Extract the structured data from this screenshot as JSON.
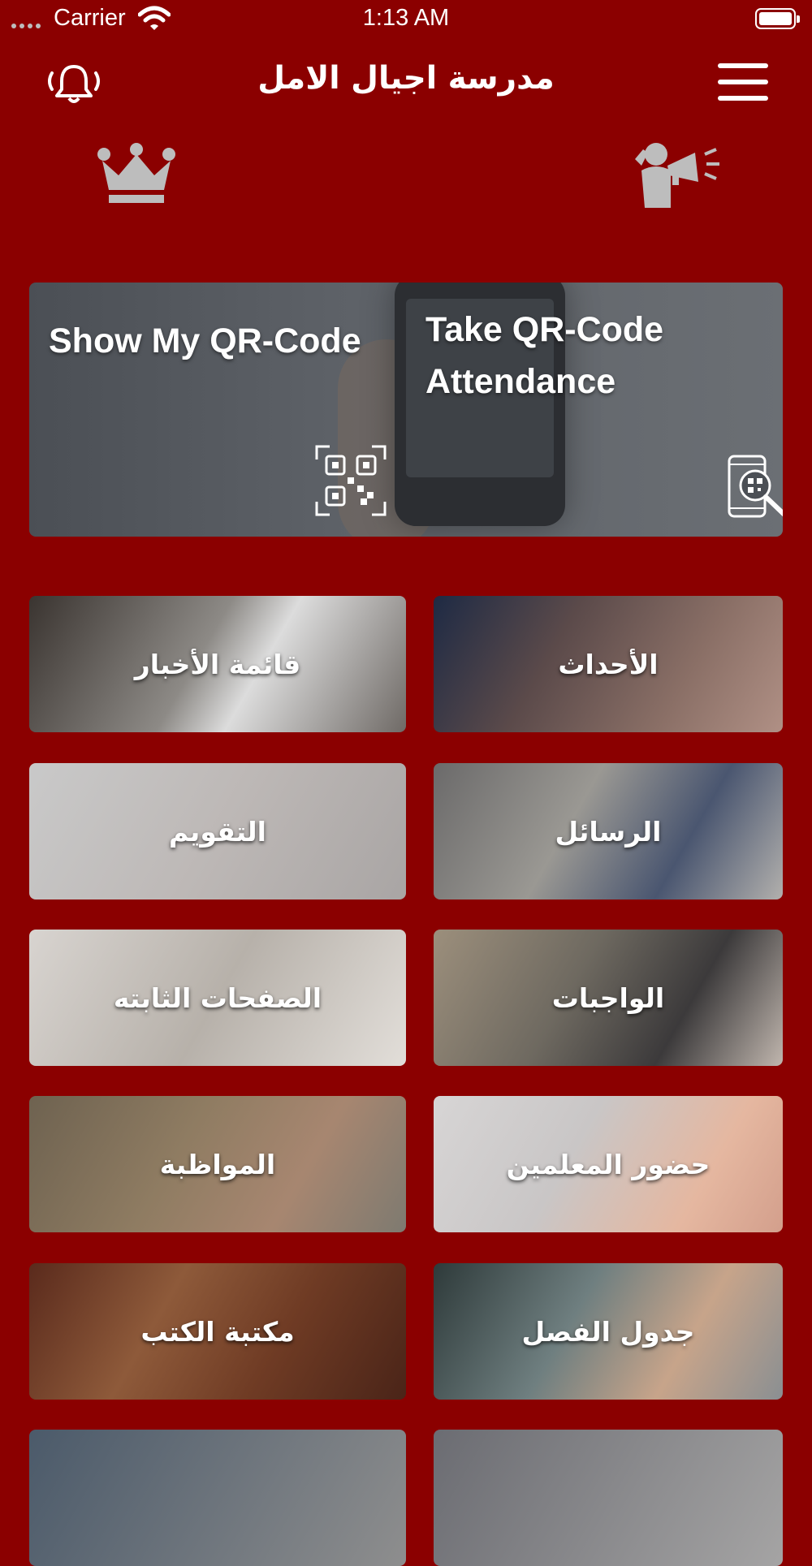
{
  "status_bar": {
    "carrier": "Carrier",
    "time": "1:13 AM"
  },
  "header": {
    "title": "مدرسة اجيال الامل"
  },
  "qr": {
    "show_label": "Show My QR-Code",
    "take_label": "Take QR-Code Attendance"
  },
  "tiles": [
    {
      "label": "قائمة الأخبار",
      "bg": "linear-gradient(120deg,#3a3430 0%,#8d8a86 45%,#dcdcdc 60%,#6f6a66 100%)"
    },
    {
      "label": "الأحداث",
      "bg": "linear-gradient(120deg,#1e2a44 0%,#5b4a4a 35%,#8a6f66 70%,#b09085 100%)"
    },
    {
      "label": "التقويم",
      "bg": "linear-gradient(120deg,#c9c9c9 0%,#bdb8b6 50%,#a9a5a4 100%)"
    },
    {
      "label": "الرسائل",
      "bg": "linear-gradient(120deg,#6b6a6a 0%,#9a9893 40%,#4a5670 70%,#b2b0ad 100%)"
    },
    {
      "label": "الصفحات الثابته",
      "bg": "linear-gradient(120deg,#d8d4d0 0%,#b7b1aa 50%,#e2ded9 100%)"
    },
    {
      "label": "الواجبات",
      "bg": "linear-gradient(120deg,#9c8f7c 0%,#6e6960 40%,#3c3a3b 70%,#c0b6ae 100%)"
    },
    {
      "label": "المواظبة",
      "bg": "linear-gradient(120deg,#6e6250 0%,#8f7c62 40%,#a78670 70%,#7e7a70 100%)"
    },
    {
      "label": "حضور المعلمين",
      "bg": "linear-gradient(120deg,#d7d5d5 0%,#c9c6c6 40%,#e5b7a0 75%,#d39f8c 100%)"
    },
    {
      "label": "مكتبة الكتب",
      "bg": "linear-gradient(120deg,#5a2a1c 0%,#8e5a3a 35%,#6f3b24 65%,#4a2418 100%)"
    },
    {
      "label": "جدول الفصل",
      "bg": "linear-gradient(120deg,#2e3a3a 0%,#6f7f80 40%,#c7a48a 70%,#8a8f92 100%)"
    },
    {
      "label": "",
      "bg": "linear-gradient(120deg,#4b5a6a 0%,#8e8e8e 100%)"
    },
    {
      "label": "",
      "bg": "linear-gradient(120deg,#6b6c72 0%,#a5a4a4 100%)"
    }
  ]
}
